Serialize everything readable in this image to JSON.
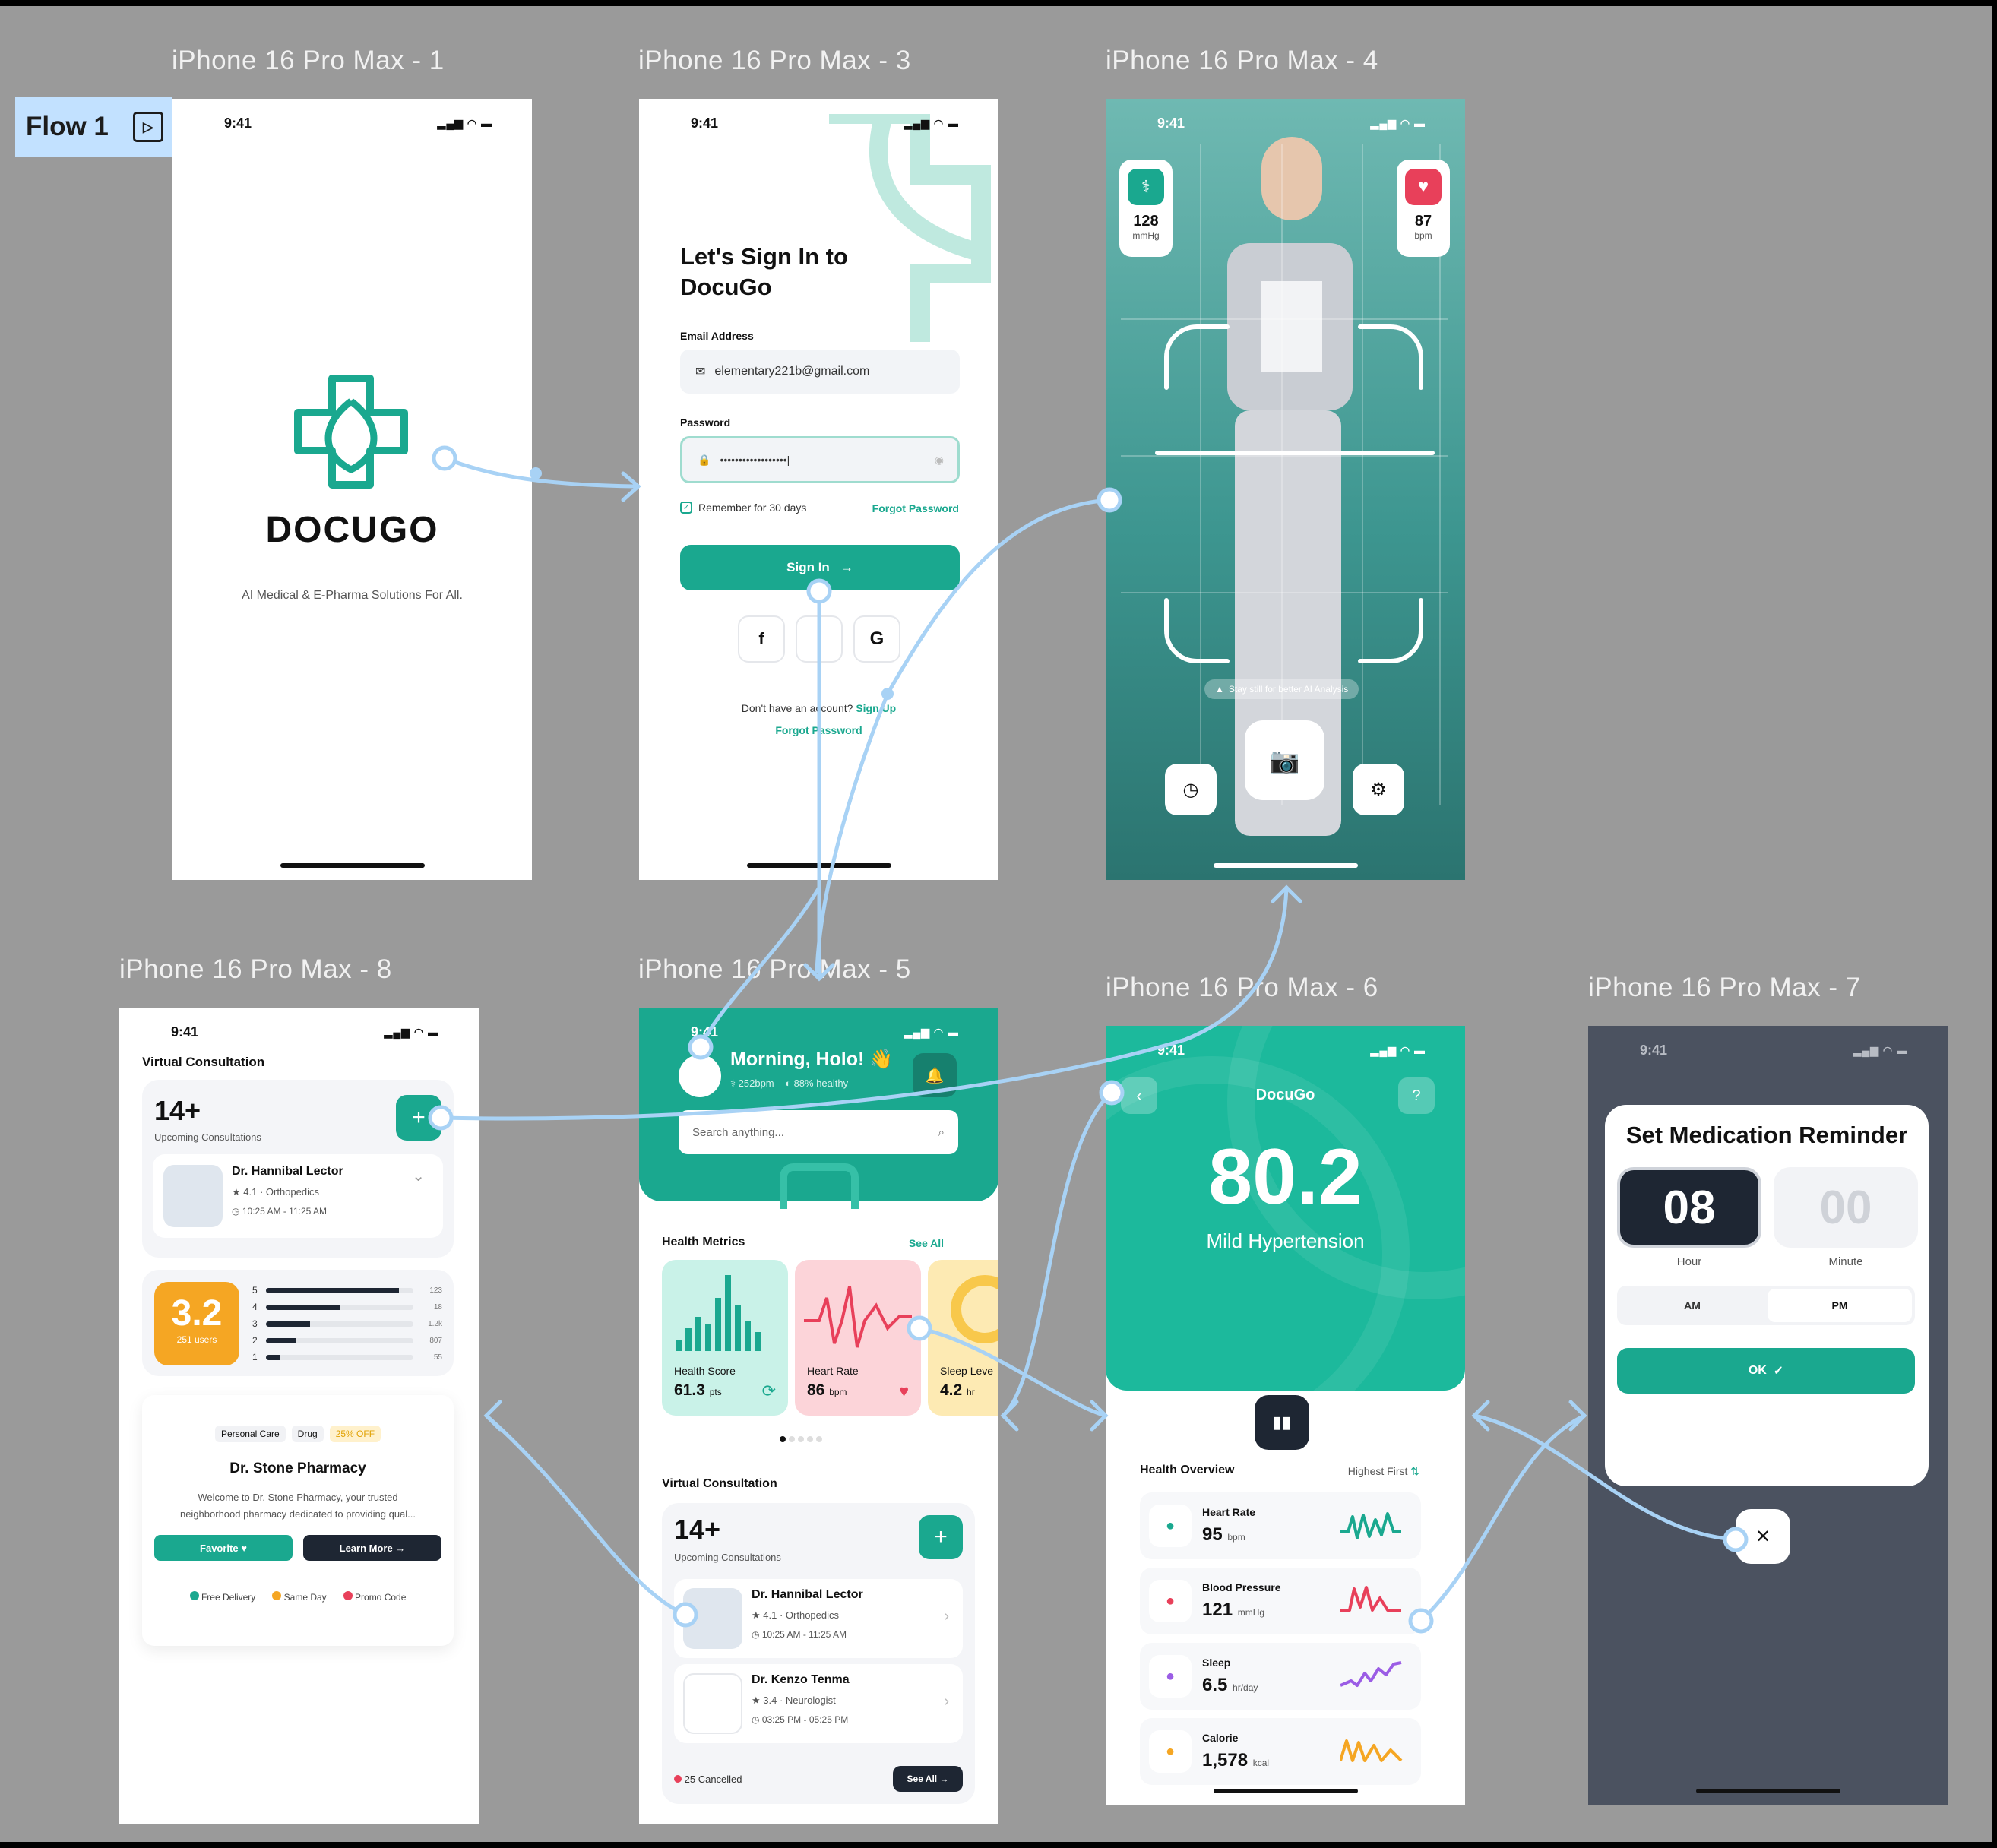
{
  "flow": {
    "label": "Flow 1"
  },
  "frames": {
    "f1": {
      "title": "iPhone 16 Pro Max - 1",
      "time": "9:41",
      "brand": "DOCUGO",
      "tagline": "AI Medical & E-Pharma Solutions For All."
    },
    "f3": {
      "title": "iPhone 16 Pro Max - 3",
      "time": "9:41",
      "heading_line1": "Let's Sign In to",
      "heading_line2": "DocuGo",
      "email_label": "Email Address",
      "email_value": "elementary221b@gmail.com",
      "password_label": "Password",
      "password_value": "••••••••••••••••••|",
      "remember": "Remember for 30 days",
      "forgot": "Forgot Password",
      "signin": "Sign In",
      "no_account": "Don't have an account?",
      "signup": "Sign Up",
      "forgot2": "Forgot Password"
    },
    "f4": {
      "title": "iPhone 16 Pro Max - 4",
      "time": "9:41",
      "bp_value": "128",
      "bp_unit": "mmHg",
      "hr_value": "87",
      "hr_unit": "bpm",
      "hint": "Stay still for better AI Analysis"
    },
    "f5": {
      "title": "iPhone 16 Pro Max - 5",
      "time": "9:41",
      "greeting": "Morning, Holo! 👋",
      "sub1": "252bpm",
      "sub2": "88% healthy",
      "search_placeholder": "Search anything...",
      "metrics_title": "Health Metrics",
      "see_all": "See All",
      "metrics": [
        {
          "label": "Health Score",
          "value": "61.3",
          "unit": "pts"
        },
        {
          "label": "Heart Rate",
          "value": "86",
          "unit": "bpm"
        },
        {
          "label": "Sleep Leve",
          "value": "4.2",
          "unit": "hr"
        }
      ],
      "vc_title": "Virtual Consultation",
      "count": "14+",
      "count_label": "Upcoming Consultations",
      "doctors": [
        {
          "name": "Dr. Hannibal Lector",
          "rating": "4.1",
          "spec": "Orthopedics",
          "time": "10:25 AM - 11:25 AM"
        },
        {
          "name": "Dr. Kenzo Tenma",
          "rating": "3.4",
          "spec": "Neurologist",
          "time": "03:25 PM - 05:25 PM"
        }
      ],
      "cancelled": "25 Cancelled",
      "see_all_btn": "See All"
    },
    "f6": {
      "title": "iPhone 16 Pro Max - 6",
      "time": "9:41",
      "app_name": "DocuGo",
      "score": "80.2",
      "status": "Mild Hypertension",
      "overview": "Health Overview",
      "sort": "Highest First",
      "items": [
        {
          "label": "Heart Rate",
          "value": "95",
          "unit": "bpm",
          "color": "#1aa88f"
        },
        {
          "label": "Blood Pressure",
          "value": "121",
          "unit": "mmHg",
          "color": "#e8405a"
        },
        {
          "label": "Sleep",
          "value": "6.5",
          "unit": "hr/day",
          "color": "#9b5de5"
        },
        {
          "label": "Calorie",
          "value": "1,578",
          "unit": "kcal",
          "color": "#f5a623"
        }
      ]
    },
    "f7": {
      "title": "iPhone 16 Pro Max - 7",
      "time": "9:41",
      "heading": "Set Medication Reminder",
      "hour": "08",
      "minute": "00",
      "hour_label": "Hour",
      "minute_label": "Minute",
      "am": "AM",
      "pm": "PM",
      "ok": "OK"
    },
    "f8": {
      "title": "iPhone 16 Pro Max - 8",
      "time": "9:41",
      "vc_title": "Virtual Consultation",
      "count": "14+",
      "count_label": "Upcoming Consultations",
      "doctor": {
        "name": "Dr. Hannibal Lector",
        "rating": "4.1",
        "spec": "Orthopedics",
        "time": "10:25 AM - 11:25 AM"
      },
      "rating_value": "3.2",
      "rating_users": "251 users",
      "bars": [
        {
          "star": "5",
          "count": "123",
          "fill": 0.9
        },
        {
          "star": "4",
          "count": "18",
          "fill": 0.5
        },
        {
          "star": "3",
          "count": "1.2k",
          "fill": 0.3
        },
        {
          "star": "2",
          "count": "807",
          "fill": 0.2
        },
        {
          "star": "1",
          "count": "55",
          "fill": 0.1
        }
      ],
      "tags": [
        "Personal Care",
        "Drug",
        "25% OFF"
      ],
      "pharmacy_name": "Dr. Stone Pharmacy",
      "pharmacy_desc1": "Welcome to Dr. Stone Pharmacy, your trusted",
      "pharmacy_desc2": "neighborhood pharmacy dedicated to providing qual...",
      "favorite": "Favorite",
      "learn_more": "Learn More",
      "features": [
        "Free Delivery",
        "Same Day",
        "Promo Code"
      ]
    }
  },
  "colors": {
    "teal": "#1aa88f",
    "canvas": "#9a9a9a",
    "connector": "#a8d2f5",
    "dark": "#1e2633",
    "orange": "#f5a623"
  }
}
